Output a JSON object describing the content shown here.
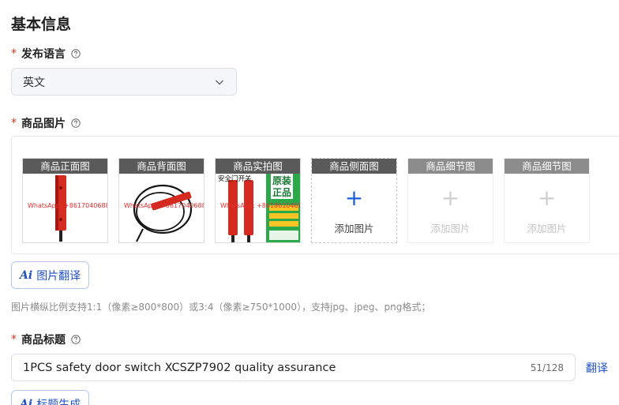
{
  "section_title": "基本信息",
  "language": {
    "label": "发布语言",
    "required_mark": "*",
    "value": "英文"
  },
  "images": {
    "label": "商品图片",
    "required_mark": "*",
    "slots": [
      {
        "caption": "商品正面图",
        "watermark": "WhatsApp: +8617040688"
      },
      {
        "caption": "商品背面图",
        "watermark": "WhatsApp: +8617040688"
      },
      {
        "caption": "商品实拍图",
        "watermark": "WhatsApp: +8618610468"
      },
      {
        "caption": "商品侧面图",
        "add_text": "添加图片",
        "plus": "+"
      },
      {
        "caption": "商品细节图",
        "add_text": "添加图片",
        "plus": "+"
      },
      {
        "caption": "商品细节图",
        "add_text": "添加图片",
        "plus": "+"
      }
    ],
    "ai_button_mark": "Ai",
    "ai_button_label": "图片翻译",
    "hint": "图片横纵比例支持1:1（像素≥800*800）或3:4（像素≥750*1000），支持jpg、jpeg、png格式；"
  },
  "product_title": {
    "label": "商品标题",
    "required_mark": "*",
    "value": "1PCS safety door switch XCSZP7902 quality assurance",
    "counter": "51/128",
    "translate_link": "翻译",
    "ai_button_mark": "Ai",
    "ai_button_label": "标题生成"
  },
  "photo3_overlay": {
    "top_text": "安全门开关",
    "badge_line1": "原装",
    "badge_line2": "正品"
  },
  "colors": {
    "required": "#e0301e",
    "accent": "#2151c5",
    "product_red": "#d42a1f"
  }
}
